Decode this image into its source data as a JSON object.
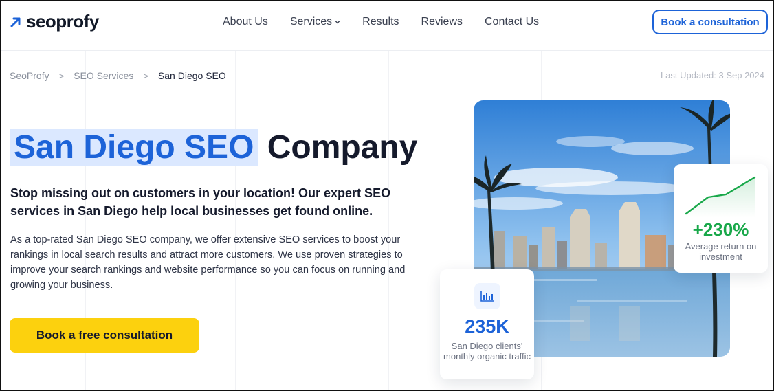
{
  "header": {
    "logo_text": "seoprofy",
    "nav": [
      "About Us",
      "Services",
      "Results",
      "Reviews",
      "Contact Us"
    ],
    "cta_label": "Book a consultation"
  },
  "breadcrumb": {
    "items": [
      "SeoProfy",
      "SEO Services",
      "San Diego SEO"
    ],
    "separator": ">"
  },
  "last_updated": "Last Updated: 3 Sep 2024",
  "hero": {
    "title_highlight": "San Diego SEO",
    "title_rest": "Company",
    "lead": "Stop missing out on customers in your location! Our expert SEO services in San Diego help local businesses get found online.",
    "body": "As a top-rated San Diego SEO company, we offer extensive SEO services to boost your rankings in local search results and attract more customers. We use proven strategies to improve your search rankings and website performance so you can focus on running and growing your business.",
    "cta_label": "Book a free consultation"
  },
  "stats": {
    "traffic": {
      "value": "235K",
      "label": "San Diego clients' monthly organic traffic",
      "icon": "bar-chart-icon"
    },
    "roi": {
      "value": "+230%",
      "label": "Average return on investment",
      "icon": "growth-line-icon"
    }
  },
  "colors": {
    "brand_blue": "#1d63d8",
    "highlight_bg": "#dbe8ff",
    "cta_yellow": "#fcd10e",
    "growth_green": "#19a84a"
  }
}
